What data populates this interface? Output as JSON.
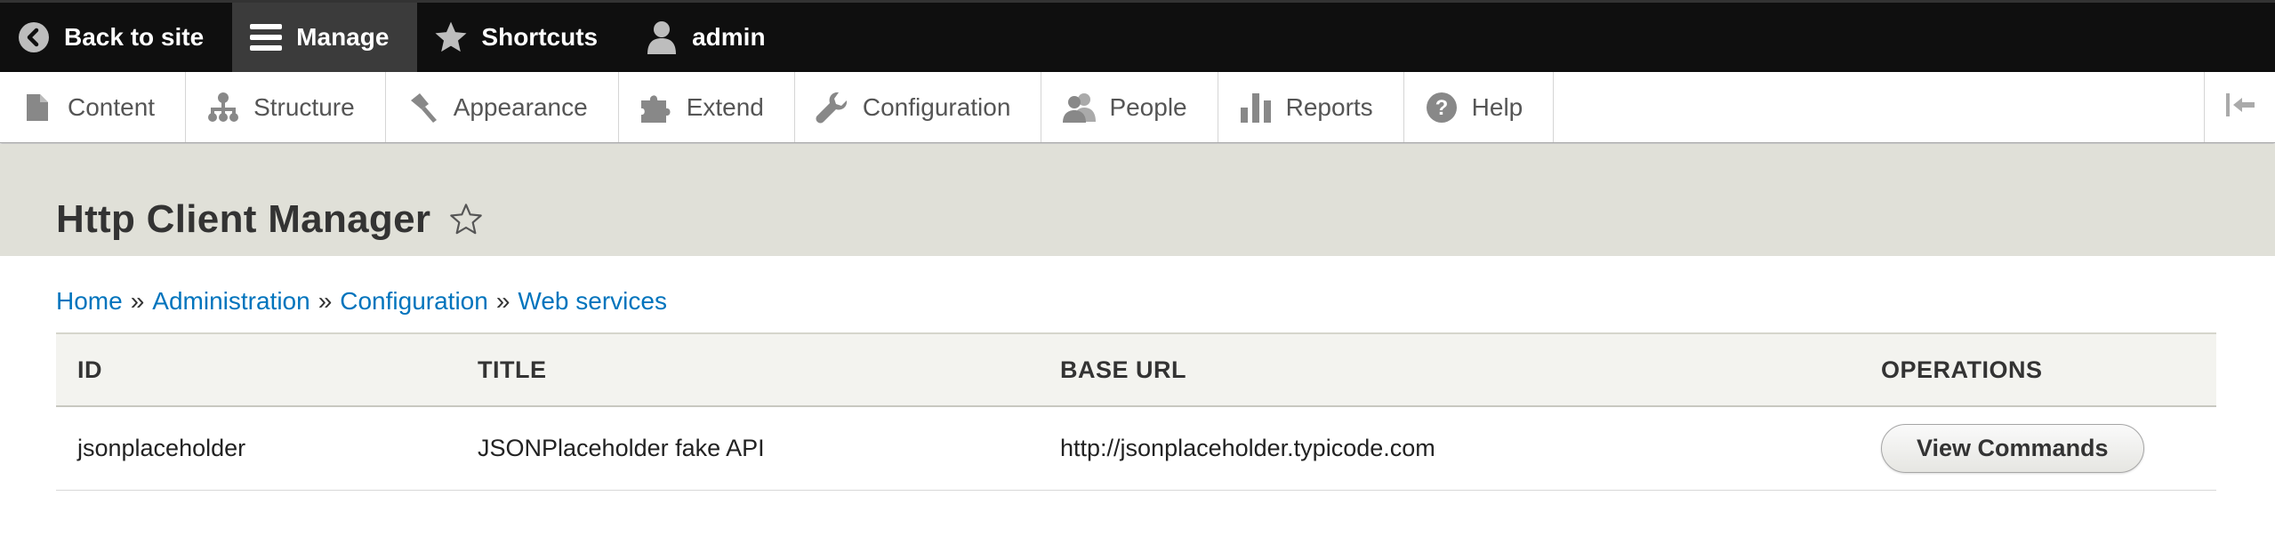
{
  "toolbar": {
    "back_label": "Back to site",
    "manage_label": "Manage",
    "shortcuts_label": "Shortcuts",
    "user_label": "admin"
  },
  "tray": {
    "items": [
      {
        "label": "Content",
        "icon": "document-icon"
      },
      {
        "label": "Structure",
        "icon": "sitemap-icon"
      },
      {
        "label": "Appearance",
        "icon": "paintbrush-icon"
      },
      {
        "label": "Extend",
        "icon": "puzzle-icon"
      },
      {
        "label": "Configuration",
        "icon": "wrench-icon"
      },
      {
        "label": "People",
        "icon": "people-icon"
      },
      {
        "label": "Reports",
        "icon": "bar-chart-icon"
      },
      {
        "label": "Help",
        "icon": "help-icon"
      }
    ]
  },
  "page": {
    "title": "Http Client Manager"
  },
  "breadcrumb": {
    "items": [
      "Home",
      "Administration",
      "Configuration",
      "Web services"
    ],
    "separator": "»"
  },
  "table": {
    "headers": [
      "ID",
      "TITLE",
      "BASE URL",
      "OPERATIONS"
    ],
    "rows": [
      {
        "id": "jsonplaceholder",
        "title": "JSONPlaceholder fake API",
        "base_url": "http://jsonplaceholder.typicode.com",
        "operation": "View Commands"
      }
    ]
  },
  "colors": {
    "toolbar_bg": "#0f0f0f",
    "active_tab_bg": "#3b3b3b",
    "header_band": "#e0e0d8",
    "link": "#0074bd"
  }
}
